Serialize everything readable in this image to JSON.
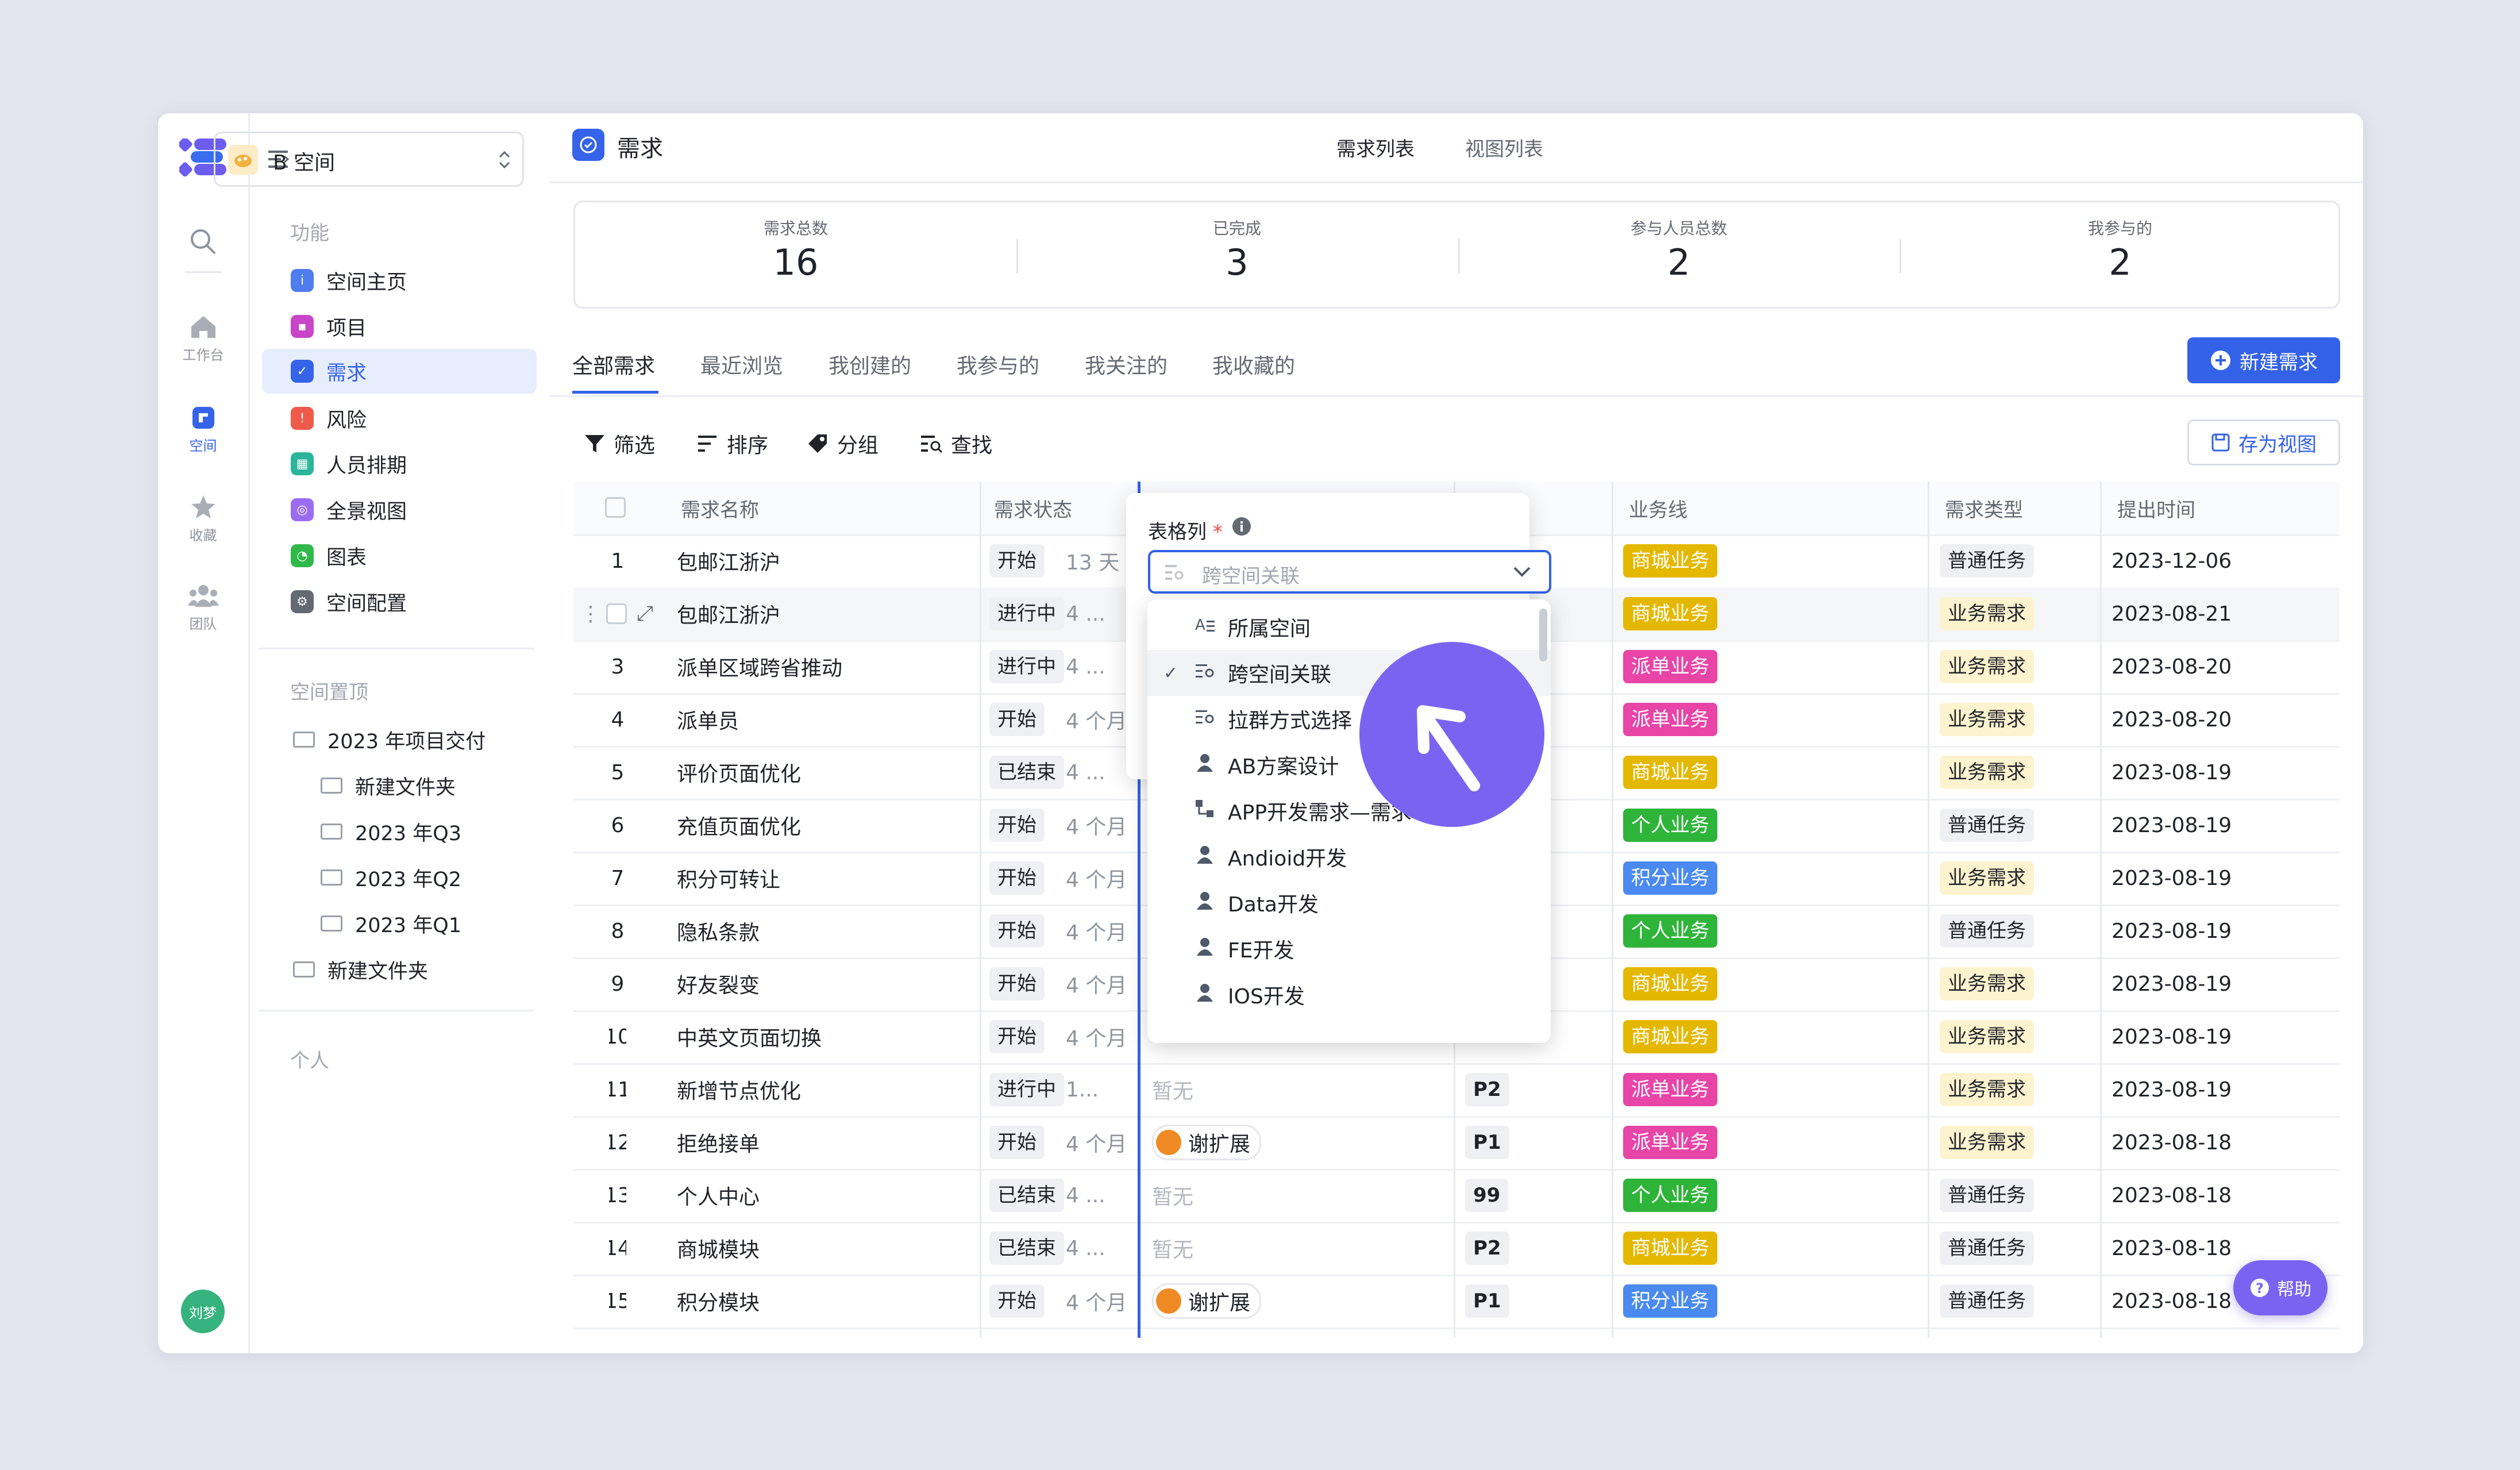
{
  "sidebar_rail": {
    "items": [
      {
        "label": "工作台",
        "icon": "home-icon"
      },
      {
        "label": "空间",
        "icon": "space-icon"
      },
      {
        "label": "收藏",
        "icon": "star-icon"
      },
      {
        "label": "团队",
        "icon": "team-icon"
      }
    ],
    "avatar_text": "刘梦"
  },
  "space_selector": {
    "label": "B 空间"
  },
  "sidebar": {
    "section_function": "功能",
    "nav": [
      {
        "label": "空间主页",
        "color": "#4f7df0"
      },
      {
        "label": "项目",
        "color": "#c845c7"
      },
      {
        "label": "需求",
        "color": "#3563e9"
      },
      {
        "label": "风险",
        "color": "#f05a4a"
      },
      {
        "label": "人员排期",
        "color": "#2bb59a"
      },
      {
        "label": "全景视图",
        "color": "#9a6cf0"
      },
      {
        "label": "图表",
        "color": "#30b94a"
      },
      {
        "label": "空间配置",
        "color": "#646a73"
      }
    ],
    "section_pinned": "空间置顶",
    "folders": [
      {
        "label": "2023 年项目交付",
        "level": 0
      },
      {
        "label": "新建文件夹",
        "level": 1
      },
      {
        "label": "2023 年Q3",
        "level": 1
      },
      {
        "label": "2023 年Q2",
        "level": 1
      },
      {
        "label": "2023 年Q1",
        "level": 1
      },
      {
        "label": "新建文件夹",
        "level": 0
      }
    ],
    "section_personal": "个人"
  },
  "header": {
    "title": "需求",
    "tabs": [
      "需求列表",
      "视图列表"
    ]
  },
  "stats": [
    {
      "label": "需求总数",
      "value": "16"
    },
    {
      "label": "已完成",
      "value": "3"
    },
    {
      "label": "参与人员总数",
      "value": "2"
    },
    {
      "label": "我参与的",
      "value": "2"
    }
  ],
  "filter_tabs": [
    "全部需求",
    "最近浏览",
    "我创建的",
    "我参与的",
    "我关注的",
    "我收藏的"
  ],
  "new_button": "新建需求",
  "toolbar": {
    "filter": "筛选",
    "sort": "排序",
    "group": "分组",
    "search": "查找",
    "save_view": "存为视图"
  },
  "table": {
    "headers": [
      "需求名称",
      "需求状态",
      "业务线",
      "需求类型",
      "提出时间"
    ],
    "rows": [
      {
        "no": "1",
        "name": "包邮江浙沪",
        "status": "开始",
        "time": "13 天",
        "person": "",
        "priority": "",
        "biz": "商城业务",
        "type": "普通任务",
        "date": "2023-12-06"
      },
      {
        "no": "",
        "name": "包邮江浙沪",
        "status": "进行中",
        "time": "4 ...",
        "person": "",
        "priority": "",
        "biz": "商城业务",
        "type": "业务需求",
        "date": "2023-08-21"
      },
      {
        "no": "3",
        "name": "派单区域跨省推动",
        "status": "进行中",
        "time": "4 ...",
        "person": "",
        "priority": "",
        "biz": "派单业务",
        "type": "业务需求",
        "date": "2023-08-20"
      },
      {
        "no": "4",
        "name": "派单员",
        "status": "开始",
        "time": "4 个月",
        "person": "",
        "priority": "",
        "biz": "派单业务",
        "type": "业务需求",
        "date": "2023-08-20"
      },
      {
        "no": "5",
        "name": "评价页面优化",
        "status": "已结束",
        "time": "4 ...",
        "person": "",
        "priority": "",
        "biz": "商城业务",
        "type": "业务需求",
        "date": "2023-08-19"
      },
      {
        "no": "6",
        "name": "充值页面优化",
        "status": "开始",
        "time": "4 个月",
        "person": "",
        "priority": "",
        "biz": "个人业务",
        "type": "普通任务",
        "date": "2023-08-19"
      },
      {
        "no": "7",
        "name": "积分可转让",
        "status": "开始",
        "time": "4 个月",
        "person": "",
        "priority": "",
        "biz": "积分业务",
        "type": "业务需求",
        "date": "2023-08-19"
      },
      {
        "no": "8",
        "name": "隐私条款",
        "status": "开始",
        "time": "4 个月",
        "person": "",
        "priority": "",
        "biz": "个人业务",
        "type": "普通任务",
        "date": "2023-08-19"
      },
      {
        "no": "9",
        "name": "好友裂变",
        "status": "开始",
        "time": "4 个月",
        "person": "",
        "priority": "",
        "biz": "商城业务",
        "type": "业务需求",
        "date": "2023-08-19"
      },
      {
        "no": "10",
        "name": "中英文页面切换",
        "status": "开始",
        "time": "4 个月",
        "person": "",
        "priority": "",
        "biz": "商城业务",
        "type": "业务需求",
        "date": "2023-08-19"
      },
      {
        "no": "11",
        "name": "新增节点优化",
        "status": "进行中",
        "time": "1...",
        "person": "暂无",
        "priority": "P2",
        "biz": "派单业务",
        "type": "业务需求",
        "date": "2023-08-19"
      },
      {
        "no": "12",
        "name": "拒绝接单",
        "status": "开始",
        "time": "4 个月",
        "person": "谢扩展",
        "priority": "P1",
        "biz": "派单业务",
        "type": "业务需求",
        "date": "2023-08-18"
      },
      {
        "no": "13",
        "name": "个人中心",
        "status": "已结束",
        "time": "4 ...",
        "person": "暂无",
        "priority": "99",
        "biz": "个人业务",
        "type": "普通任务",
        "date": "2023-08-18"
      },
      {
        "no": "14",
        "name": "商城模块",
        "status": "已结束",
        "time": "4 ...",
        "person": "暂无",
        "priority": "P2",
        "biz": "商城业务",
        "type": "普通任务",
        "date": "2023-08-18"
      },
      {
        "no": "15",
        "name": "积分模块",
        "status": "开始",
        "time": "4 个月",
        "person": "谢扩展",
        "priority": "P1",
        "biz": "积分业务",
        "type": "普通任务",
        "date": "2023-08-18"
      }
    ]
  },
  "biz_colors": {
    "商城业务": "#e5b800",
    "派单业务": "#e845a7",
    "个人业务": "#2fb43a",
    "积分业务": "#4a8af0"
  },
  "type_colors": {
    "普通任务": "#eef0f3",
    "业务需求": "#fdf3cf"
  },
  "dropdown": {
    "label": "表格列",
    "required_mark": "*",
    "selected": "跨空间关联",
    "options": [
      {
        "label": "所属空间",
        "icon": "text-icon",
        "checked": false
      },
      {
        "label": "跨空间关联",
        "icon": "relation-icon",
        "checked": true
      },
      {
        "label": "拉群方式选择",
        "icon": "relation-icon",
        "checked": false
      },
      {
        "label": "AB方案设计",
        "icon": "person-icon",
        "checked": false
      },
      {
        "label": "APP开发需求—需求",
        "icon": "flow-icon",
        "checked": false
      },
      {
        "label": "Andioid开发",
        "icon": "person-icon",
        "checked": false
      },
      {
        "label": "Data开发",
        "icon": "person-icon",
        "checked": false
      },
      {
        "label": "FE开发",
        "icon": "person-icon",
        "checked": false
      },
      {
        "label": "IOS开发",
        "icon": "person-icon",
        "checked": false
      }
    ]
  },
  "help_button": "帮助"
}
